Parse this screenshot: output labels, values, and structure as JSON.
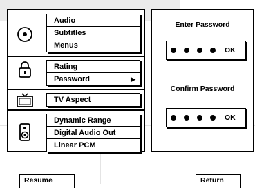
{
  "menu": {
    "groups": [
      {
        "icon": "disc-icon",
        "items": [
          "Audio",
          "Subtitles",
          "Menus"
        ]
      },
      {
        "icon": "lock-icon",
        "items": [
          "Rating",
          "Password"
        ]
      },
      {
        "icon": "tv-icon",
        "items": [
          "TV Aspect"
        ]
      },
      {
        "icon": "speaker-icon",
        "items": [
          "Dynamic Range",
          "Digital Audio Out",
          "Linear PCM"
        ]
      }
    ]
  },
  "password": {
    "enter_label": "Enter Password",
    "confirm_label": "Confirm Password",
    "ok_label": "OK"
  },
  "buttons": {
    "resume": "Resume",
    "return": "Return"
  }
}
